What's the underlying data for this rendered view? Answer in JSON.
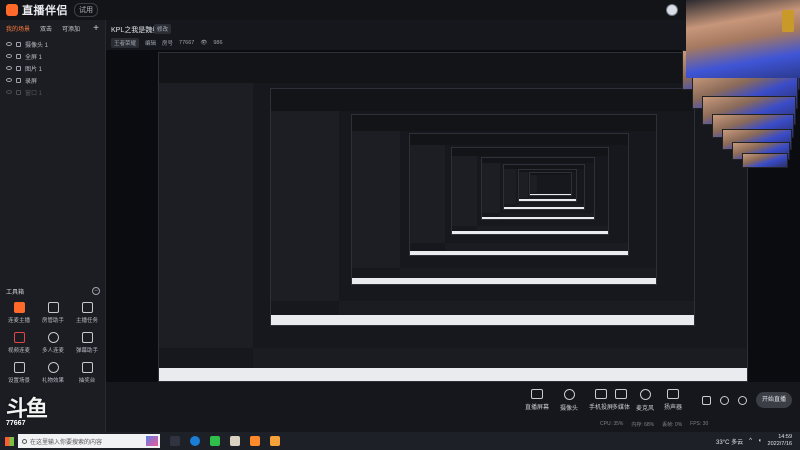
{
  "app": {
    "name": "直播伴侣",
    "version_tag": "试用"
  },
  "sidebar": {
    "tabs": [
      {
        "label": "我的场景",
        "active": true
      },
      {
        "label": "双击",
        "active": false
      },
      {
        "label": "可添加",
        "active": false
      }
    ],
    "add_label": "+",
    "sources": [
      {
        "label": "摄像头 1"
      },
      {
        "label": "全屏 1"
      },
      {
        "label": "图片 1"
      },
      {
        "label": "录屏"
      },
      {
        "label": "窗口 1"
      }
    ]
  },
  "toolbox": {
    "title": "工具箱",
    "collapse_label": "−",
    "tools": [
      {
        "label": "连麦主播",
        "icon": "mic-link-icon",
        "style": "hot"
      },
      {
        "label": "房管助手",
        "icon": "user-admin-icon",
        "style": ""
      },
      {
        "label": "主播任务",
        "icon": "task-icon",
        "style": ""
      },
      {
        "label": "视频连麦",
        "icon": "video-link-icon",
        "style": "hot2"
      },
      {
        "label": "多人连麦",
        "icon": "group-link-icon",
        "style": "round"
      },
      {
        "label": "弹幕助手",
        "icon": "danmaku-icon",
        "style": ""
      },
      {
        "label": "设置场景",
        "icon": "scene-icon",
        "style": ""
      },
      {
        "label": "礼物效果",
        "icon": "gift-icon",
        "style": "round"
      },
      {
        "label": "抽奖台",
        "icon": "lottery-icon",
        "style": ""
      }
    ]
  },
  "room": {
    "title": "KPL之我是魏维",
    "title_tag": "修改",
    "category": "王者荣耀",
    "category_tag": "编辑",
    "room_id_label": "房号",
    "room_id": "77667",
    "online": "986"
  },
  "controls": {
    "items": [
      {
        "label": "直播屏幕",
        "icon": "screen-icon",
        "round": false
      },
      {
        "label": "摄像头",
        "icon": "camera-icon",
        "round": true
      },
      {
        "label": "手机投屏",
        "icon": "phone-cast-icon",
        "round": false
      },
      {
        "label": "多媒体",
        "icon": "media-icon",
        "round": false
      },
      {
        "label": "麦克风",
        "icon": "microphone-icon",
        "round": true
      },
      {
        "label": "扬声器",
        "icon": "speaker-icon",
        "round": false
      }
    ],
    "start_label": "开始直播"
  },
  "status": {
    "items": [
      "CPU: 35%",
      "内存: 68%",
      "丢帧: 0%",
      "FPS: 30"
    ]
  },
  "watermark": {
    "brand": "斗鱼",
    "room": "77667"
  },
  "taskbar": {
    "search_placeholder": "在这里输入你要搜索的内容",
    "weather": "33°C 多云",
    "time": "14:59",
    "date": "2022/7/16"
  }
}
